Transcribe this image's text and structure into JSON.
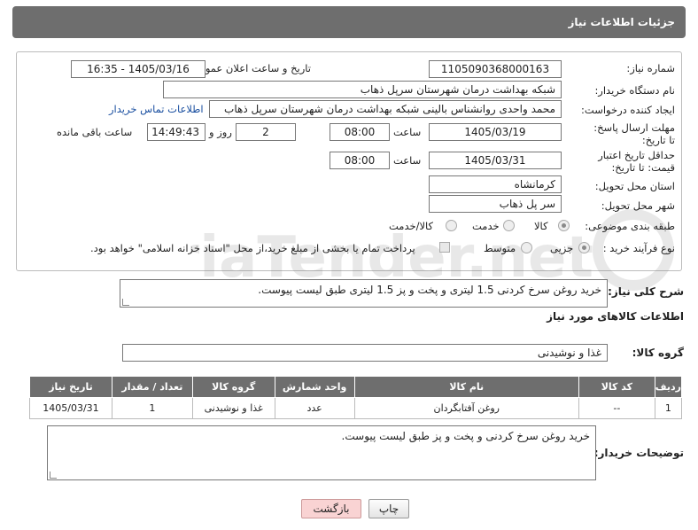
{
  "header": {
    "title": "جزئیات اطلاعات نیاز"
  },
  "form": {
    "need_number_label": "شماره نیاز:",
    "need_number": "1105090368000163",
    "announce_label": "تاریخ و ساعت اعلان عمومی:",
    "announce_value": "1405/03/16 - 16:35",
    "buyer_label": "نام دستگاه خریدار:",
    "buyer_value": "شبکه بهداشت درمان شهرستان سرپل ذهاب",
    "creator_label": "ایجاد کننده درخواست:",
    "creator_value": "محمد واحدی روانشناس بالینی شبکه بهداشت درمان شهرستان سرپل ذهاب",
    "contact_link": "اطلاعات تماس خریدار",
    "deadline_label": "مهلت ارسال پاسخ: تا تاریخ:",
    "deadline_date": "1405/03/19",
    "time_label": "ساعت",
    "deadline_time": "08:00",
    "days_value": "2",
    "days_label": "روز و",
    "remaining_time": "14:49:43",
    "remaining_label": "ساعت باقی مانده",
    "validity_label": "حداقل تاریخ اعتبار قیمت: تا تاریخ:",
    "validity_date": "1405/03/31",
    "validity_time": "08:00",
    "province_label": "استان محل تحویل:",
    "province_value": "کرمانشاه",
    "city_label": "شهر محل تحویل:",
    "city_value": "سر پل ذهاب",
    "category_label": "طبقه بندی موضوعی:",
    "category_options": [
      "کالا",
      "خدمت",
      "کالا/خدمت"
    ],
    "category_selected": "کالا",
    "process_label": "نوع فرآیند خرید :",
    "process_options": [
      "جزیی",
      "متوسط"
    ],
    "process_selected": "جزیی",
    "payment_note": "پرداخت تمام یا بخشی از مبلغ خرید،از محل \"اسناد خزانه اسلامی\" خواهد بود."
  },
  "description": {
    "label": "شرح کلی نیاز:",
    "value": "خرید روغن سرخ کردنی 1.5 لیتری و پخت و پز 1.5 لیتری  طبق لیست پیوست."
  },
  "goods": {
    "section_title": "اطلاعات کالاهای مورد نیاز",
    "group_label": "گروه کالا:",
    "group_value": "غذا و نوشیدنی",
    "columns": [
      "ردیف",
      "کد کالا",
      "نام کالا",
      "واحد شمارش",
      "گروه کالا",
      "تعداد / مقدار",
      "تاریخ نیاز"
    ],
    "rows": [
      [
        "1",
        "--",
        "روغن آفتابگردان",
        "عدد",
        "غذا و نوشیدنی",
        "1",
        "1405/03/31"
      ]
    ]
  },
  "buyer_notes": {
    "label": "توضیحات خریدار:",
    "value": "خرید روغن سرخ کردنی و پخت و پز طبق لیست پیوست."
  },
  "buttons": {
    "print": "چاپ",
    "back": "بازگشت"
  },
  "watermark": {
    "text": "AriaTender.net"
  }
}
